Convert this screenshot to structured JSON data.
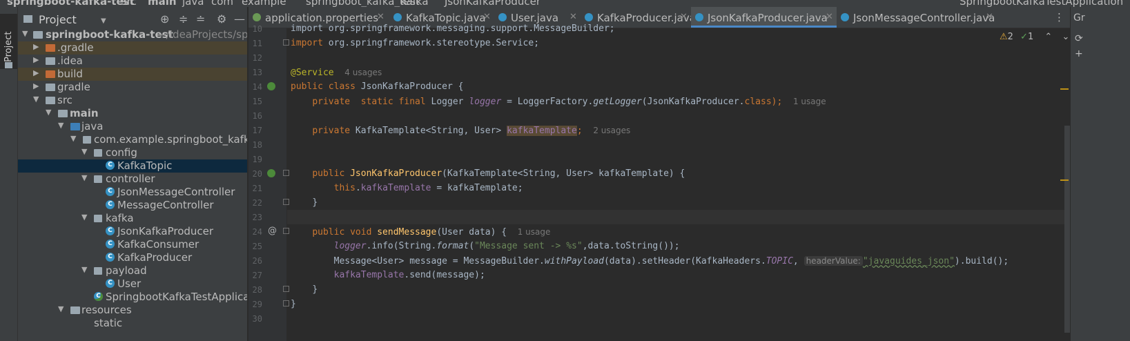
{
  "breadcrumb": [
    "springboot-kafka-test",
    "src",
    "main",
    "java",
    "com",
    "example",
    "springboot_kafka_test",
    "kafka",
    "JsonKafkaProducer"
  ],
  "run_config": "SpringbootKafkaTestApplication",
  "sidebar_tab": "Project",
  "project_panel": {
    "title": "Project",
    "root_name": "springboot-kafka-test",
    "root_path": "~/IdeaProjects/spring",
    "tree": [
      {
        "label": ".gradle",
        "kind": "folder-orange"
      },
      {
        "label": ".idea",
        "kind": "folder"
      },
      {
        "label": "build",
        "kind": "folder-orange"
      },
      {
        "label": "gradle",
        "kind": "folder"
      },
      {
        "label": "src",
        "kind": "folder"
      },
      {
        "label": "main",
        "kind": "folder"
      },
      {
        "label": "java",
        "kind": "folder-blue"
      },
      {
        "label": "com.example.springboot_kafka_te",
        "kind": "package"
      },
      {
        "label": "config",
        "kind": "package"
      },
      {
        "label": "KafkaTopic",
        "kind": "class"
      },
      {
        "label": "controller",
        "kind": "package"
      },
      {
        "label": "JsonMessageController",
        "kind": "class"
      },
      {
        "label": "MessageController",
        "kind": "class"
      },
      {
        "label": "kafka",
        "kind": "package"
      },
      {
        "label": "JsonKafkaProducer",
        "kind": "class"
      },
      {
        "label": "KafkaConsumer",
        "kind": "class"
      },
      {
        "label": "KafkaProducer",
        "kind": "class"
      },
      {
        "label": "payload",
        "kind": "package"
      },
      {
        "label": "User",
        "kind": "class"
      },
      {
        "label": "SpringbootKafkaTestApplicatio",
        "kind": "class-run"
      },
      {
        "label": "resources",
        "kind": "folder"
      },
      {
        "label": "static",
        "kind": "folder"
      }
    ]
  },
  "tabs": [
    {
      "label": "application.properties"
    },
    {
      "label": "KafkaTopic.java"
    },
    {
      "label": "User.java"
    },
    {
      "label": "KafkaProducer.java"
    },
    {
      "label": "JsonKafkaProducer.java",
      "active": true
    },
    {
      "label": "JsonMessageController.java"
    }
  ],
  "inspection": {
    "warnings": "2",
    "ok": "1"
  },
  "editor": {
    "line_numbers": [
      "10",
      "11",
      "12",
      "13",
      "14",
      "15",
      "16",
      "17",
      "18",
      "19",
      "20",
      "21",
      "22",
      "23",
      "24",
      "25",
      "26",
      "27",
      "28",
      "29",
      "30"
    ],
    "l10": "import org.springframework.messaging.support.MessageBuilder;",
    "l11_kw": "import",
    "l11_rest": " org.springframework.stereotype.Service;",
    "l13_ann": "@Service",
    "l13_hint": "4 usages",
    "l14_kw": "public class",
    "l14_rest": " JsonKafkaProducer {",
    "l15_kw": "private  static final",
    "l15_type": " Logger ",
    "l15_field": "logger",
    "l15_eq": " = LoggerFactory.",
    "l15_method": "getLogger",
    "l15_arg": "(JsonKafkaProducer.",
    "l15_kwclass": "class",
    "l15_end": ");",
    "l15_hint": "1 usage",
    "l17_kw": "private",
    "l17_type": " KafkaTemplate<String, User> ",
    "l17_field": "kafkaTemplate",
    "l17_end": ";",
    "l17_hint": "2 usages",
    "l20_kw": "public",
    "l20_name": "JsonKafkaProducer",
    "l20_rest": "(KafkaTemplate<String, User> kafkaTemplate) {",
    "l21_kw": "this",
    "l21_dot": ".",
    "l21_field": "kafkaTemplate",
    "l21_rest": " = kafkaTemplate;",
    "l22": "}",
    "l24_kw": "public void",
    "l24_name": "sendMessage",
    "l24_rest": "(User data) {",
    "l24_hint": "1 usage",
    "l25_field": "logger",
    "l25_a": ".info(String.",
    "l25_method": "format",
    "l25_b": "(",
    "l25_str": "\"Message sent -> %s\"",
    "l25_c": ",data.toString());",
    "l26_a": "Message<User> message = MessageBuilder.",
    "l26_method": "withPayload",
    "l26_b": "(data).setHeader(KafkaHeaders.",
    "l26_const": "TOPIC",
    "l26_c": ",",
    "l26_param": "headerValue:",
    "l26_str": "\"javaguides_json\"",
    "l26_d": ").build();",
    "l27_field": "kafkaTemplate",
    "l27_rest": ".send(message);",
    "l28": "}",
    "l29": "}"
  }
}
